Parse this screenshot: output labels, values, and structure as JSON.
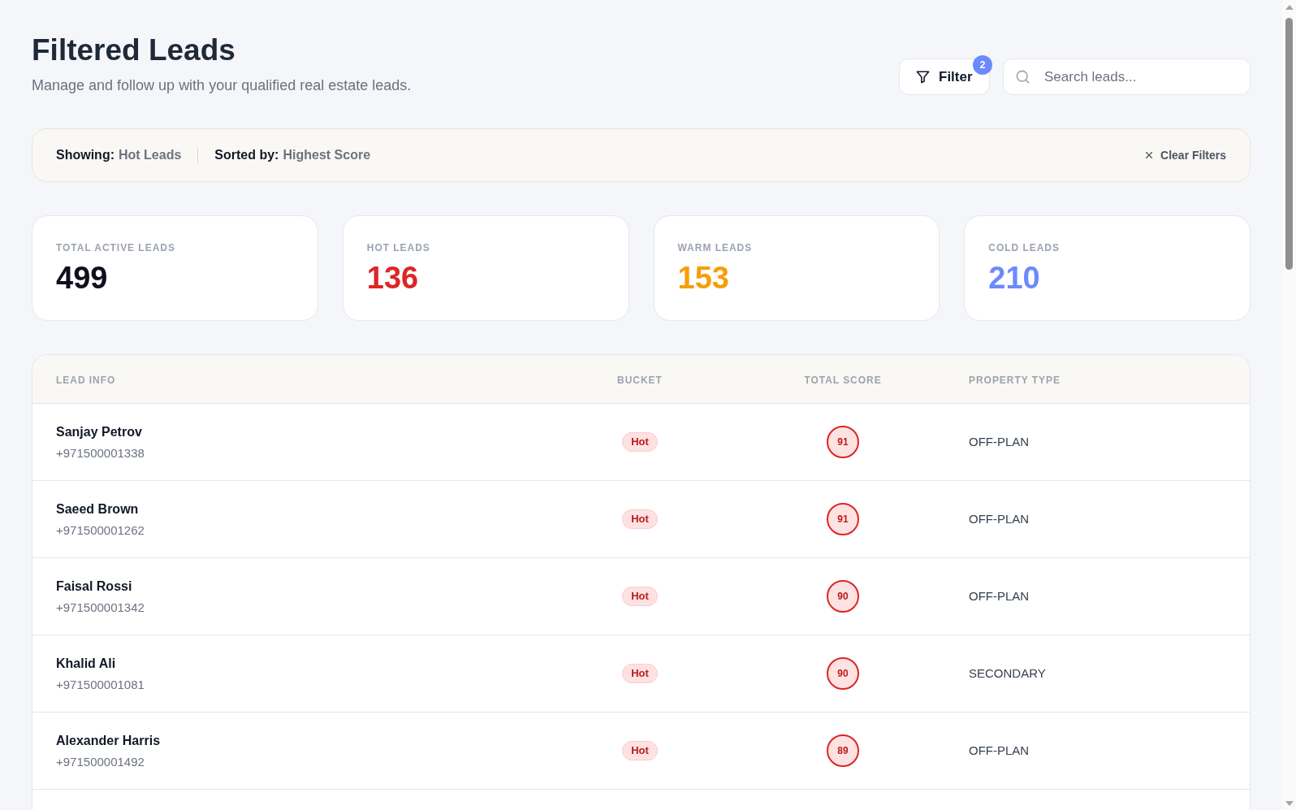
{
  "header": {
    "title": "Filtered Leads",
    "subtitle": "Manage and follow up with your qualified real estate leads.",
    "filter_button": {
      "label": "Filter",
      "badge": "2"
    },
    "search": {
      "placeholder": "Search leads..."
    }
  },
  "active_filters": {
    "items": [
      {
        "label": "Showing:",
        "value": "Hot Leads"
      },
      {
        "label": "Sorted by:",
        "value": "Highest Score"
      }
    ],
    "clear_button": "Clear Filters"
  },
  "stats": [
    {
      "label": "TOTAL ACTIVE LEADS",
      "value": "499",
      "color": "#0f0f1f"
    },
    {
      "label": "HOT LEADS",
      "value": "136",
      "color": "#dc2626"
    },
    {
      "label": "WARM LEADS",
      "value": "153",
      "color": "#f59e0b"
    },
    {
      "label": "COLD LEADS",
      "value": "210",
      "color": "#6b8afd"
    }
  ],
  "table": {
    "columns": [
      "LEAD INFO",
      "BUCKET",
      "TOTAL SCORE",
      "PROPERTY TYPE"
    ],
    "rows": [
      {
        "name": "Sanjay Petrov",
        "phone": "+971500001338",
        "bucket": "Hot",
        "score": "91",
        "property_type": "OFF-PLAN"
      },
      {
        "name": "Saeed Brown",
        "phone": "+971500001262",
        "bucket": "Hot",
        "score": "91",
        "property_type": "OFF-PLAN"
      },
      {
        "name": "Faisal Rossi",
        "phone": "+971500001342",
        "bucket": "Hot",
        "score": "90",
        "property_type": "OFF-PLAN"
      },
      {
        "name": "Khalid Ali",
        "phone": "+971500001081",
        "bucket": "Hot",
        "score": "90",
        "property_type": "SECONDARY"
      },
      {
        "name": "Alexander Harris",
        "phone": "+971500001492",
        "bucket": "Hot",
        "score": "89",
        "property_type": "OFF-PLAN"
      }
    ]
  }
}
